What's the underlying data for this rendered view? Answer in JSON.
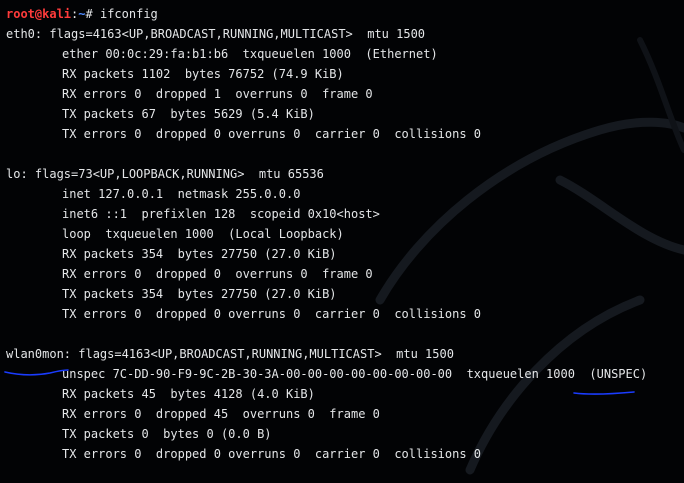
{
  "prompt": {
    "user_host": "root@kali",
    "separator": ":",
    "path": "~",
    "symbol": "#",
    "command": "ifconfig"
  },
  "lines": [
    "eth0: flags=4163<UP,BROADCAST,RUNNING,MULTICAST>  mtu 1500",
    "ether 00:0c:29:fa:b1:b6  txqueuelen 1000  (Ethernet)",
    "RX packets 1102  bytes 76752 (74.9 KiB)",
    "RX errors 0  dropped 1  overruns 0  frame 0",
    "TX packets 67  bytes 5629 (5.4 KiB)",
    "TX errors 0  dropped 0 overruns 0  carrier 0  collisions 0",
    "lo: flags=73<UP,LOOPBACK,RUNNING>  mtu 65536",
    "inet 127.0.0.1  netmask 255.0.0.0",
    "inet6 ::1  prefixlen 128  scopeid 0x10<host>",
    "loop  txqueuelen 1000  (Local Loopback)",
    "RX packets 354  bytes 27750 (27.0 KiB)",
    "RX errors 0  dropped 0  overruns 0  frame 0",
    "TX packets 354  bytes 27750 (27.0 KiB)",
    "TX errors 0  dropped 0 overruns 0  carrier 0  collisions 0",
    "wlan0mon: flags=4163<UP,BROADCAST,RUNNING,MULTICAST>  mtu 1500",
    "unspec 7C-DD-90-F9-9C-2B-30-3A-00-00-00-00-00-00-00-00  txqueuelen 1000  (UNSPEC)",
    "RX packets 45  bytes 4128 (4.0 KiB)",
    "RX errors 0  dropped 45  overruns 0  frame 0",
    "TX packets 0  bytes 0 (0.0 B)",
    "TX errors 0  dropped 0 overruns 0  carrier 0  collisions 0"
  ],
  "colors": {
    "background": "#020305",
    "text": "#e4e6e8",
    "prompt_user": "#ff3b3b",
    "prompt_path": "#4f8bff",
    "annotation": "#1a3cff"
  },
  "annotations": [
    {
      "type": "handwritten-underline",
      "target": "wlan0mon"
    },
    {
      "type": "handwritten-underline",
      "target": "(UNSPEC)"
    }
  ]
}
